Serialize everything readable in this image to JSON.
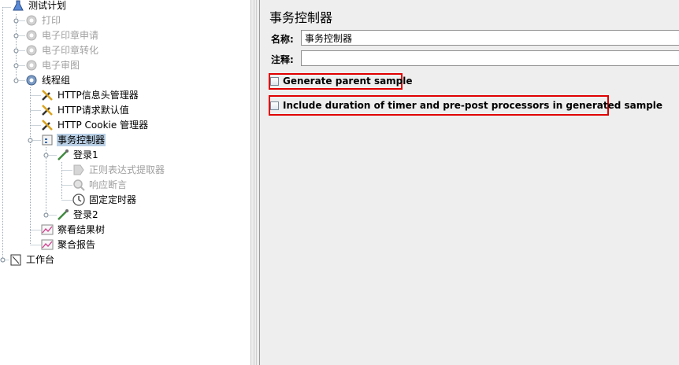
{
  "tree": {
    "nodes": [
      {
        "id": "test-plan",
        "label": "测试计划",
        "disabled": false,
        "selected": false
      },
      {
        "id": "print",
        "label": "打印",
        "disabled": true,
        "selected": false
      },
      {
        "id": "seal-apply",
        "label": "电子印章申请",
        "disabled": true,
        "selected": false
      },
      {
        "id": "seal-convert",
        "label": "电子印章转化",
        "disabled": true,
        "selected": false
      },
      {
        "id": "e-review",
        "label": "电子审图",
        "disabled": true,
        "selected": false
      },
      {
        "id": "thread-group",
        "label": "线程组",
        "disabled": false,
        "selected": false
      },
      {
        "id": "http-header",
        "label": "HTTP信息头管理器",
        "disabled": false,
        "selected": false
      },
      {
        "id": "http-defaults",
        "label": "HTTP请求默认值",
        "disabled": false,
        "selected": false
      },
      {
        "id": "http-cookie",
        "label": "HTTP Cookie 管理器",
        "disabled": false,
        "selected": false
      },
      {
        "id": "transaction-controller",
        "label": "事务控制器",
        "disabled": false,
        "selected": true
      },
      {
        "id": "login1",
        "label": "登录1",
        "disabled": false,
        "selected": false
      },
      {
        "id": "regex-extractor",
        "label": "正则表达式提取器",
        "disabled": true,
        "selected": false
      },
      {
        "id": "response-assertion",
        "label": "响应断言",
        "disabled": true,
        "selected": false
      },
      {
        "id": "constant-timer",
        "label": "固定定时器",
        "disabled": false,
        "selected": false
      },
      {
        "id": "login2",
        "label": "登录2",
        "disabled": false,
        "selected": false
      },
      {
        "id": "view-results-tree",
        "label": "察看结果树",
        "disabled": false,
        "selected": false
      },
      {
        "id": "aggregate-report",
        "label": "聚合报告",
        "disabled": false,
        "selected": false
      },
      {
        "id": "workbench",
        "label": "工作台",
        "disabled": false,
        "selected": false
      }
    ]
  },
  "panel": {
    "title": "事务控制器",
    "name_label": "名称:",
    "name_value": "事务控制器",
    "comment_label": "注释:",
    "comment_value": "",
    "generate_parent_label": "Generate parent sample",
    "generate_parent_checked": false,
    "include_duration_label": "Include duration of timer and pre-post processors in generated sample",
    "include_duration_checked": false
  },
  "colors": {
    "highlight": "#e00000",
    "selection": "#b8cfe5",
    "panel_background": "#eeeeee"
  }
}
